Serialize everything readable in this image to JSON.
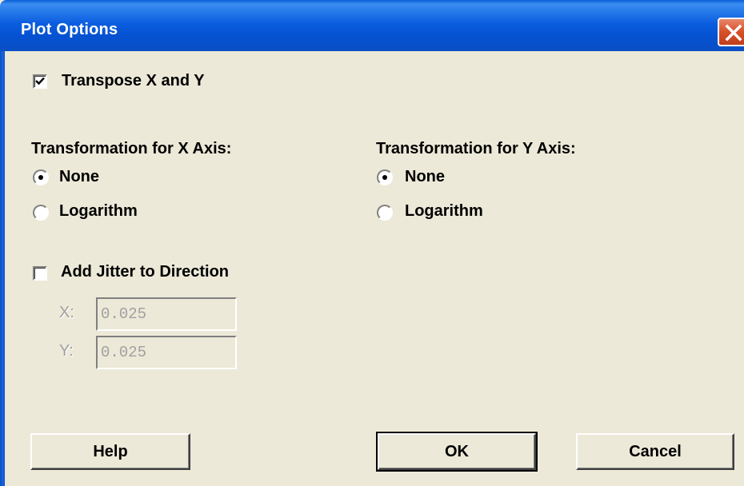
{
  "window": {
    "title": "Plot Options"
  },
  "transpose": {
    "label": "Transpose X and Y",
    "checked": true
  },
  "x_axis": {
    "heading": "Transformation for X Axis:",
    "options": [
      "None",
      "Logarithm"
    ],
    "selected": "None"
  },
  "y_axis": {
    "heading": "Transformation for Y Axis:",
    "options": [
      "None",
      "Logarithm"
    ],
    "selected": "None"
  },
  "jitter": {
    "label": "Add Jitter to Direction",
    "checked": false,
    "x_label": "X:",
    "x_value": "0.025",
    "y_label": "Y:",
    "y_value": "0.025"
  },
  "buttons": {
    "help": "Help",
    "ok": "OK",
    "cancel": "Cancel"
  },
  "colors": {
    "titlebar": "#0552d2",
    "dialog_bg": "#ece9d8",
    "close_button": "#d5502a",
    "disabled_text": "#a0a0a0"
  },
  "icons": {
    "close": "close-icon",
    "check": "checkmark-icon"
  }
}
